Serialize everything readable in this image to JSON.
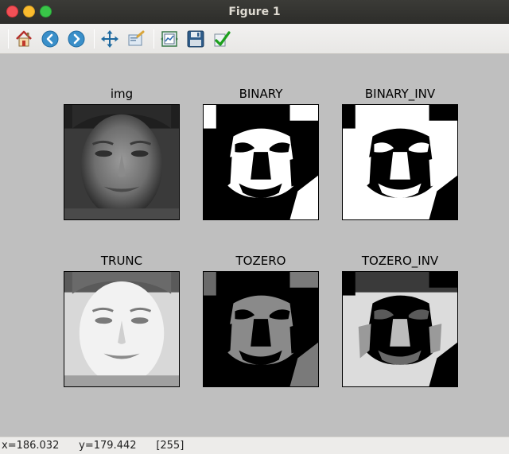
{
  "window": {
    "title": "Figure 1"
  },
  "toolbar": {
    "buttons": [
      {
        "name": "home-icon",
        "tooltip": "Home"
      },
      {
        "name": "back-icon",
        "tooltip": "Back"
      },
      {
        "name": "forward-icon",
        "tooltip": "Forward"
      },
      {
        "name": "pan-icon",
        "tooltip": "Pan"
      },
      {
        "name": "zoom-icon",
        "tooltip": "Zoom"
      },
      {
        "name": "configure-subplots-icon",
        "tooltip": "Subplots"
      },
      {
        "name": "save-icon",
        "tooltip": "Save"
      },
      {
        "name": "edit-axis-icon",
        "tooltip": "Customize"
      }
    ]
  },
  "subplots": [
    {
      "title": "img",
      "variant": "gray"
    },
    {
      "title": "BINARY",
      "variant": "binary"
    },
    {
      "title": "BINARY_INV",
      "variant": "binary_inv"
    },
    {
      "title": "TRUNC",
      "variant": "trunc"
    },
    {
      "title": "TOZERO",
      "variant": "tozero"
    },
    {
      "title": "TOZERO_INV",
      "variant": "tozero_inv"
    }
  ],
  "status": {
    "x": "x=186.032",
    "y": "y=179.442",
    "value": "[255]"
  },
  "colors": {
    "figure_bg": "#bfbfbf",
    "titlebar_bg": "#2d2d2a",
    "toolbar_bg": "#efeeec"
  }
}
